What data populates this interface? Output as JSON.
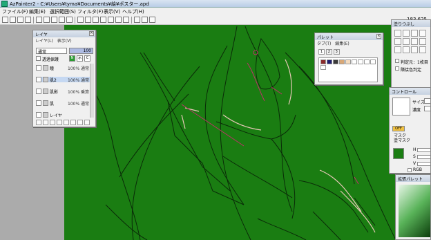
{
  "app": {
    "title": "AzPainter2 - C:¥Users¥tyma¥Documents¥絵¥ポスター.apd",
    "coord": "183,625"
  },
  "menu": [
    "ファイル(F)",
    "編集(E)",
    "選択範囲(S)",
    "フィルタ(F)",
    "表示(V)",
    "ヘルプ(H)"
  ],
  "layer_panel": {
    "title": "レイヤ",
    "tabs": [
      "レイヤ(L)",
      "表示(V)"
    ],
    "blend_mode": "通常",
    "opacity": "100",
    "lock_label": "透過保護",
    "buttons": [
      "N",
      "不",
      "C"
    ],
    "layers": [
      {
        "name": "瞳",
        "opacity": "100% 通常"
      },
      {
        "name": "肌2",
        "opacity": "100% 通常"
      },
      {
        "name": "肌影",
        "opacity": "100% 乗算"
      },
      {
        "name": "肌",
        "opacity": "100% 通常"
      },
      {
        "name": "レイヤ",
        "opacity": ""
      }
    ]
  },
  "palette_panel": {
    "title": "パレット",
    "tabs": [
      "タブ(T)",
      "編集(E)"
    ],
    "subtabs": [
      "1",
      "2",
      "3"
    ],
    "colors": [
      "#8b2c2c",
      "#202070",
      "#3a3a3a",
      "#d9a877",
      "#f5dcc0",
      "#ffffff",
      "#ffffff",
      "#ffffff",
      "#ffffff",
      "#ffffff"
    ]
  },
  "tool_panel": {
    "title": "塗りつぶし",
    "options": [
      "判定元：1枚目",
      "隣接色判定"
    ]
  },
  "control_panel": {
    "title": "コントロール",
    "size_label": "サイズ",
    "density_label": "濃度",
    "off_label": "OFF",
    "mask_label": "マスク",
    "tex_label": "塗マスク",
    "fg_color": "#1a7d12",
    "channels": [
      "H",
      "S",
      "V"
    ],
    "rgb_label": "RGB"
  },
  "expand_palette": {
    "title": "拡張パレット"
  }
}
